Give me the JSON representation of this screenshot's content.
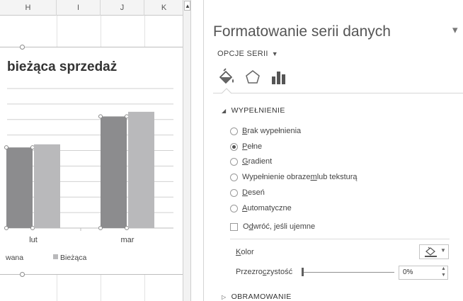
{
  "sheet": {
    "columns": [
      "H",
      "I",
      "J",
      "K"
    ]
  },
  "chart_data": {
    "type": "bar",
    "title": "bieżąca sprzedaż",
    "categories": [
      "lut",
      "mar"
    ],
    "series": [
      {
        "name": "",
        "color": "#8c8c8e",
        "values": [
          52,
          72
        ]
      },
      {
        "name": "Bieżąca",
        "color": "#b9b9bb",
        "values": [
          54,
          75
        ]
      }
    ],
    "legend_text": "wana",
    "legend_position": "bottom",
    "grid": true
  },
  "pane": {
    "title": "Formatowanie serii danych",
    "close_glyph": "×",
    "menu_glyph": "▾",
    "series_options_label": "OPCJE SERII",
    "category_icons": [
      "fill-line-icon",
      "effects-icon",
      "series-options-icon"
    ],
    "fill_section": {
      "header": "WYPEŁNIENIE",
      "options": [
        {
          "pre": "",
          "key": "B",
          "post": "rak wypełnienia",
          "checked": false
        },
        {
          "pre": "",
          "key": "P",
          "post": "ełne",
          "checked": true
        },
        {
          "pre": "",
          "key": "G",
          "post": "radient",
          "checked": false
        },
        {
          "pre": "Wypełnienie obraze",
          "key": "m",
          "post": " lub teksturą",
          "checked": false
        },
        {
          "pre": "",
          "key": "D",
          "post": "eseń",
          "checked": false
        },
        {
          "pre": "",
          "key": "A",
          "post": "utomatyczne",
          "checked": false
        }
      ],
      "invert": {
        "pre": "O",
        "key": "d",
        "post": "wróć, jeśli ujemne",
        "checked": false
      },
      "color_label": {
        "pre": "",
        "key": "K",
        "post": "olor"
      },
      "transparency_label": {
        "pre": "Przezro",
        "key": "c",
        "post": "zystość"
      },
      "transparency_value": "0%",
      "transparency_level": 0
    },
    "border_section": {
      "header": "OBRAMOWANIE"
    }
  }
}
